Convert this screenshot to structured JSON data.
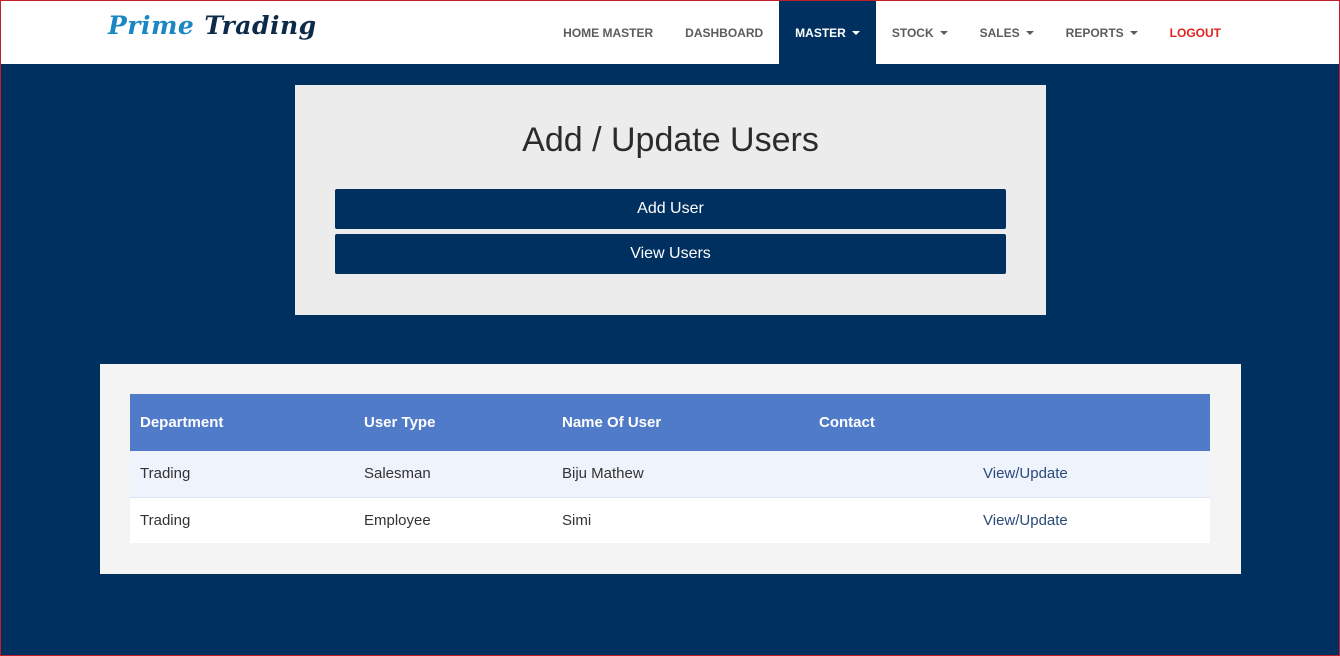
{
  "brand": {
    "part1": "Prime",
    "part2": "Trading"
  },
  "nav": {
    "items": [
      {
        "label": "HOME MASTER"
      },
      {
        "label": "DASHBOARD"
      },
      {
        "label": "MASTER"
      },
      {
        "label": "STOCK"
      },
      {
        "label": "SALES"
      },
      {
        "label": "REPORTS"
      },
      {
        "label": "LOGOUT"
      }
    ]
  },
  "panel": {
    "title": "Add / Update Users",
    "add_label": "Add User",
    "view_label": "View Users"
  },
  "table": {
    "headers": [
      "Department",
      "User Type",
      "Name Of User",
      "Contact",
      ""
    ],
    "rows": [
      {
        "department": "Trading",
        "user_type": "Salesman",
        "name": "Biju Mathew",
        "contact": "",
        "action": "View/Update"
      },
      {
        "department": "Trading",
        "user_type": "Employee",
        "name": "Simi",
        "contact": "",
        "action": "View/Update"
      }
    ]
  },
  "colors": {
    "accent": "#003060",
    "table_header": "#507bc9",
    "logout": "#e0231c",
    "brand_blue": "#1a86c4"
  }
}
